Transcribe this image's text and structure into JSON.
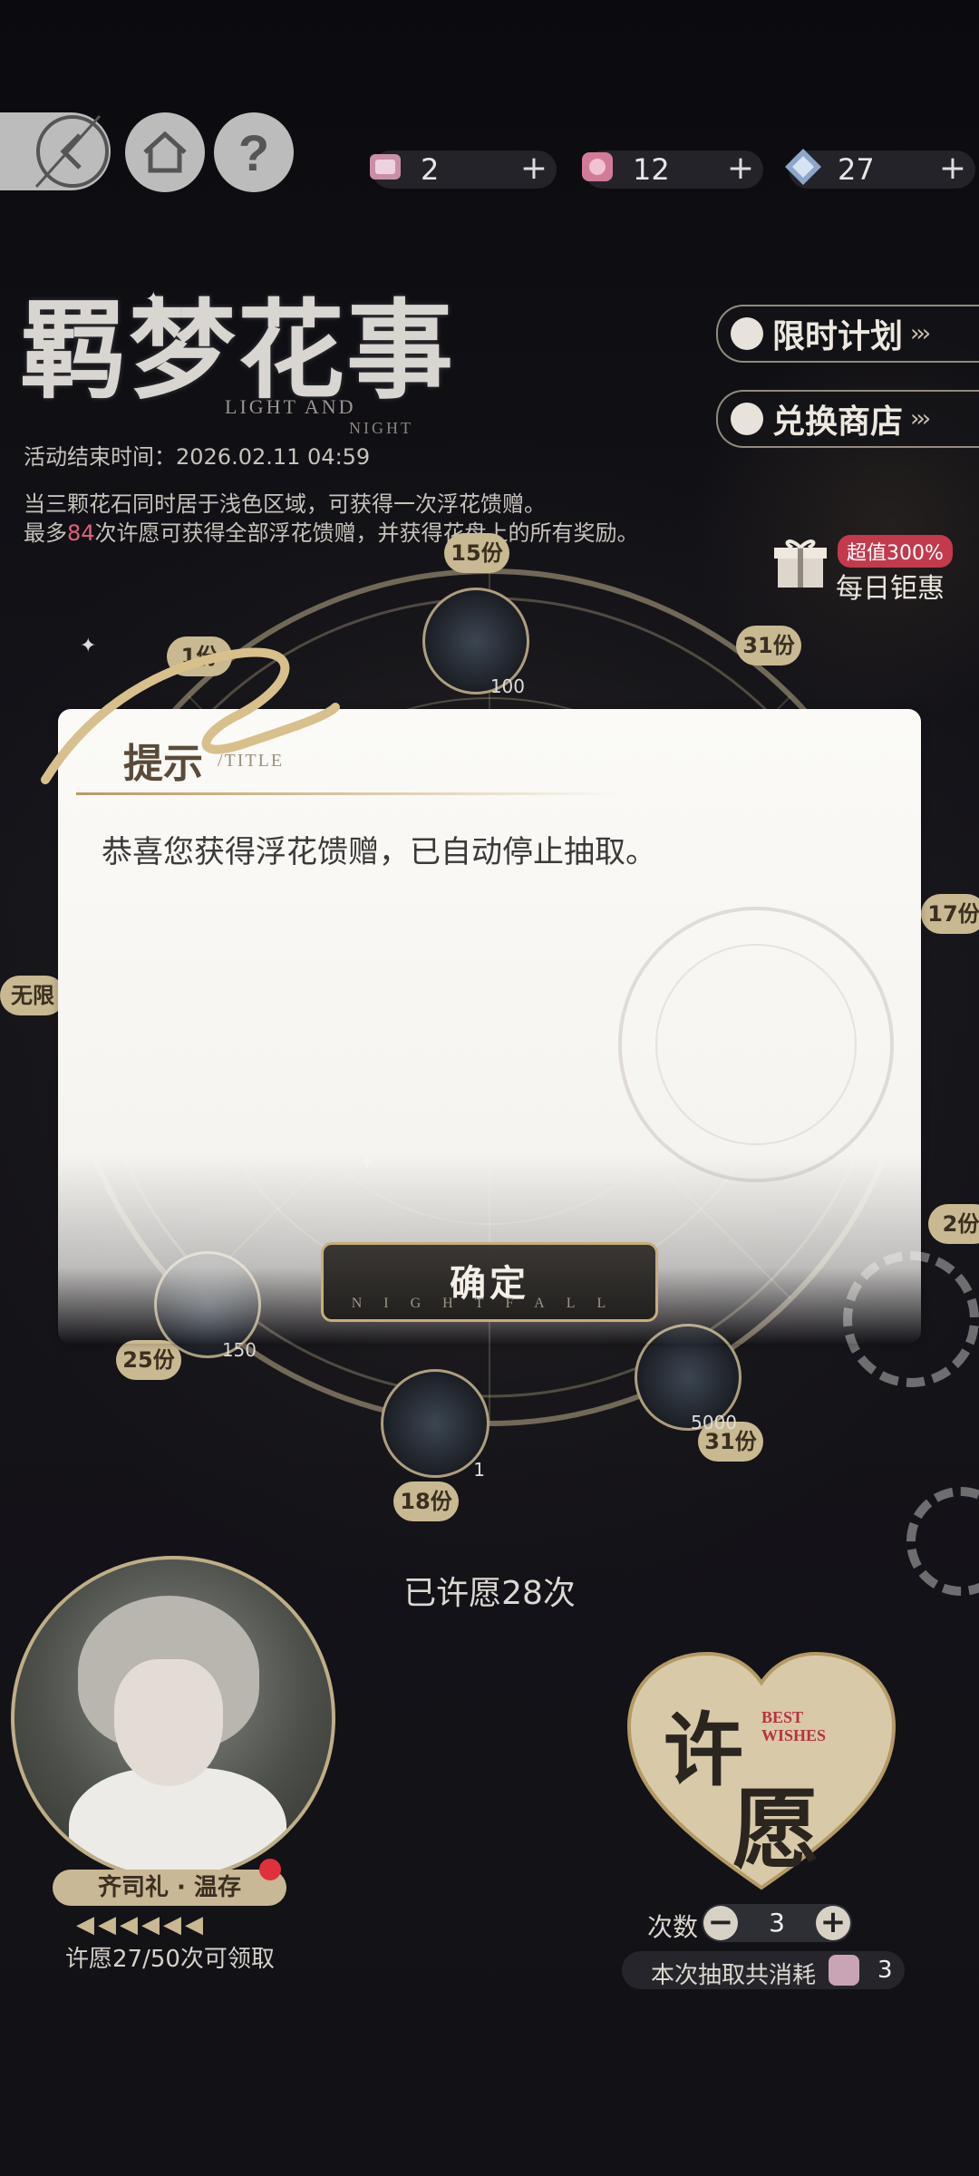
{
  "topbar": {
    "currencies": [
      {
        "icon": "wish-ticket-icon",
        "value": "2"
      },
      {
        "icon": "flower-box-icon",
        "value": "12"
      },
      {
        "icon": "diamond-icon",
        "value": "27"
      }
    ],
    "plus": "+"
  },
  "event": {
    "title": "羁梦花事",
    "title_en_1": "LIGHT AND",
    "title_en_2": "NIGHT",
    "end_time": "活动结束时间：2026.02.11 04:59",
    "desc_line1": "当三颗花石同时居于浅色区域，可获得一次浮花馈赠。",
    "desc_line2_prefix": "最多",
    "desc_line2_highlight": "84",
    "desc_line2_suffix": "次许愿可获得全部浮花馈赠，并获得花盘上的所有奖励。"
  },
  "side": {
    "limited_plan": "限时计划",
    "exchange_shop": "兑换商店",
    "arrows": "›››",
    "daily_badge": "超值300%",
    "daily_label": "每日钜惠"
  },
  "wheel": {
    "tags": [
      "15份",
      "31份",
      "17份",
      "2份",
      "31份",
      "18份",
      "25份",
      "无限",
      "1份"
    ],
    "item_counts": [
      "100",
      "150",
      "5000",
      "1"
    ]
  },
  "dialog": {
    "title": "提示",
    "title_en": "/TITLE",
    "message": "恭喜您获得浮花馈赠，已自动停止抽取。",
    "ok_label": "确定",
    "ok_sub": "NIGHTFALL"
  },
  "bottom": {
    "wished": "已许愿28次",
    "character_name": "齐司礼 · 温存",
    "flags": "◀◀◀◀◀◀",
    "progress": "许愿27/50次可领取",
    "wish_big_1": "许",
    "wish_big_2": "愿",
    "wish_en_1": "BEST",
    "wish_en_2": "WISHES",
    "count_label": "次数",
    "count_value": "3",
    "minus": "−",
    "plus": "+",
    "cost_label": "本次抽取共消耗",
    "cost_value": "3"
  },
  "colors": {
    "accent_gold": "#c9b992",
    "highlight_red": "#e0627a",
    "badge_red": "#c23a4c"
  }
}
